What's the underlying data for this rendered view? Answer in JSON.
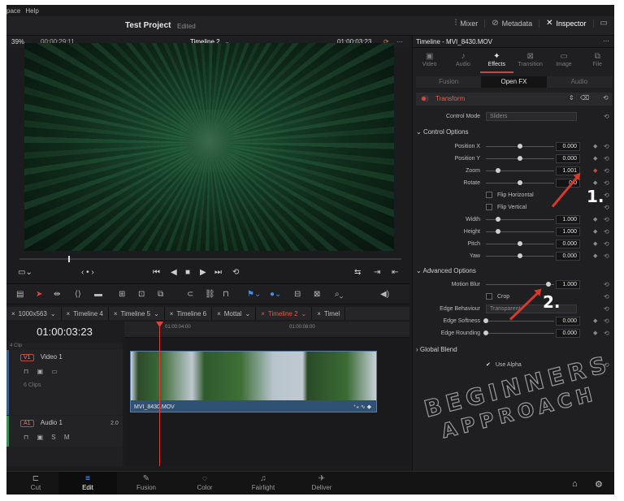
{
  "menubar": {
    "items": [
      "pace",
      "Help"
    ]
  },
  "titlebar": {
    "project": "Test Project",
    "status": "Edited",
    "right": [
      {
        "icon": "mixer-icon",
        "label": "Mixer"
      },
      {
        "icon": "metadata-icon",
        "label": "Metadata"
      },
      {
        "icon": "inspector-icon",
        "label": "Inspector"
      }
    ]
  },
  "viewer": {
    "zoom": "39%",
    "timecode_left": "00:00:29:11",
    "timeline_name": "Timeline 2",
    "timecode_right": "01:00:03:23"
  },
  "timeline_tabs": [
    "1000x563",
    "Timeline 4",
    "Timeline 5",
    "Timeline 6",
    "Mottal",
    "Timeline 2",
    "Timel"
  ],
  "timeline": {
    "timecode": "01:00:03:23",
    "ruler": [
      "01:00:04:00",
      "01:00:08:00"
    ],
    "video_track": {
      "badge": "V1",
      "name": "Video 1",
      "clips": "6 Clips"
    },
    "audio_track": {
      "badge": "A1",
      "name": "Audio 1",
      "level": "2.0"
    },
    "clip_name": "MVI_8430.MOV",
    "collapsed_clip": "4 Clip"
  },
  "pages": [
    {
      "label": "Cut",
      "icon": "cut-icon"
    },
    {
      "label": "Edit",
      "icon": "edit-icon",
      "active": true
    },
    {
      "label": "Fusion",
      "icon": "fusion-icon"
    },
    {
      "label": "Color",
      "icon": "color-icon"
    },
    {
      "label": "Fairlight",
      "icon": "fairlight-icon"
    },
    {
      "label": "Deliver",
      "icon": "deliver-icon"
    }
  ],
  "inspector": {
    "title": "Timeline - MVI_8430.MOV",
    "tabs": [
      "Video",
      "Audio",
      "Effects",
      "Transition",
      "Image",
      "File"
    ],
    "active_tab": "Effects",
    "subtabs": [
      "Fusion",
      "Open FX",
      "Audio"
    ],
    "active_subtab": "Open FX",
    "effect": "Transform",
    "control_mode_label": "Control Mode",
    "control_mode_value": "Sliders",
    "section1": "Control Options",
    "params1": [
      {
        "label": "Position X",
        "value": "0.000",
        "knob": 0.5
      },
      {
        "label": "Position Y",
        "value": "0.000",
        "knob": 0.5
      },
      {
        "label": "Zoom",
        "value": "1.001",
        "knob": 0.18
      },
      {
        "label": "Rotate",
        "value": "0.0",
        "knob": 0.5
      }
    ],
    "flip_h": "Flip Horizontal",
    "flip_v": "Flip Vertical",
    "params2": [
      {
        "label": "Width",
        "value": "1.000",
        "knob": 0.18
      },
      {
        "label": "Height",
        "value": "1.000",
        "knob": 0.18
      },
      {
        "label": "Pitch",
        "value": "0.000",
        "knob": 0.5
      },
      {
        "label": "Yaw",
        "value": "0.000",
        "knob": 0.5
      }
    ],
    "section2": "Advanced Options",
    "motion_blur_label": "Motion Blur",
    "motion_blur_value": "1.000",
    "crop_label": "Crop",
    "edge_behaviour_label": "Edge Behaviour",
    "edge_behaviour_value": "Transparent",
    "edge_softness_label": "Edge Softness",
    "edge_softness_value": "0.000",
    "edge_rounding_label": "Edge Rounding",
    "edge_rounding_value": "0.000",
    "section3": "Global Blend",
    "use_alpha": "Use Alpha"
  },
  "annotations": {
    "n1": "1.",
    "n2": "2."
  },
  "watermark": {
    "line1": "BEGINNERS",
    "line2": "APPROACH"
  },
  "colors": {
    "accent_red": "#c24a3f",
    "playhead": "#e0413a",
    "edit_blue": "#6aa6ff"
  }
}
